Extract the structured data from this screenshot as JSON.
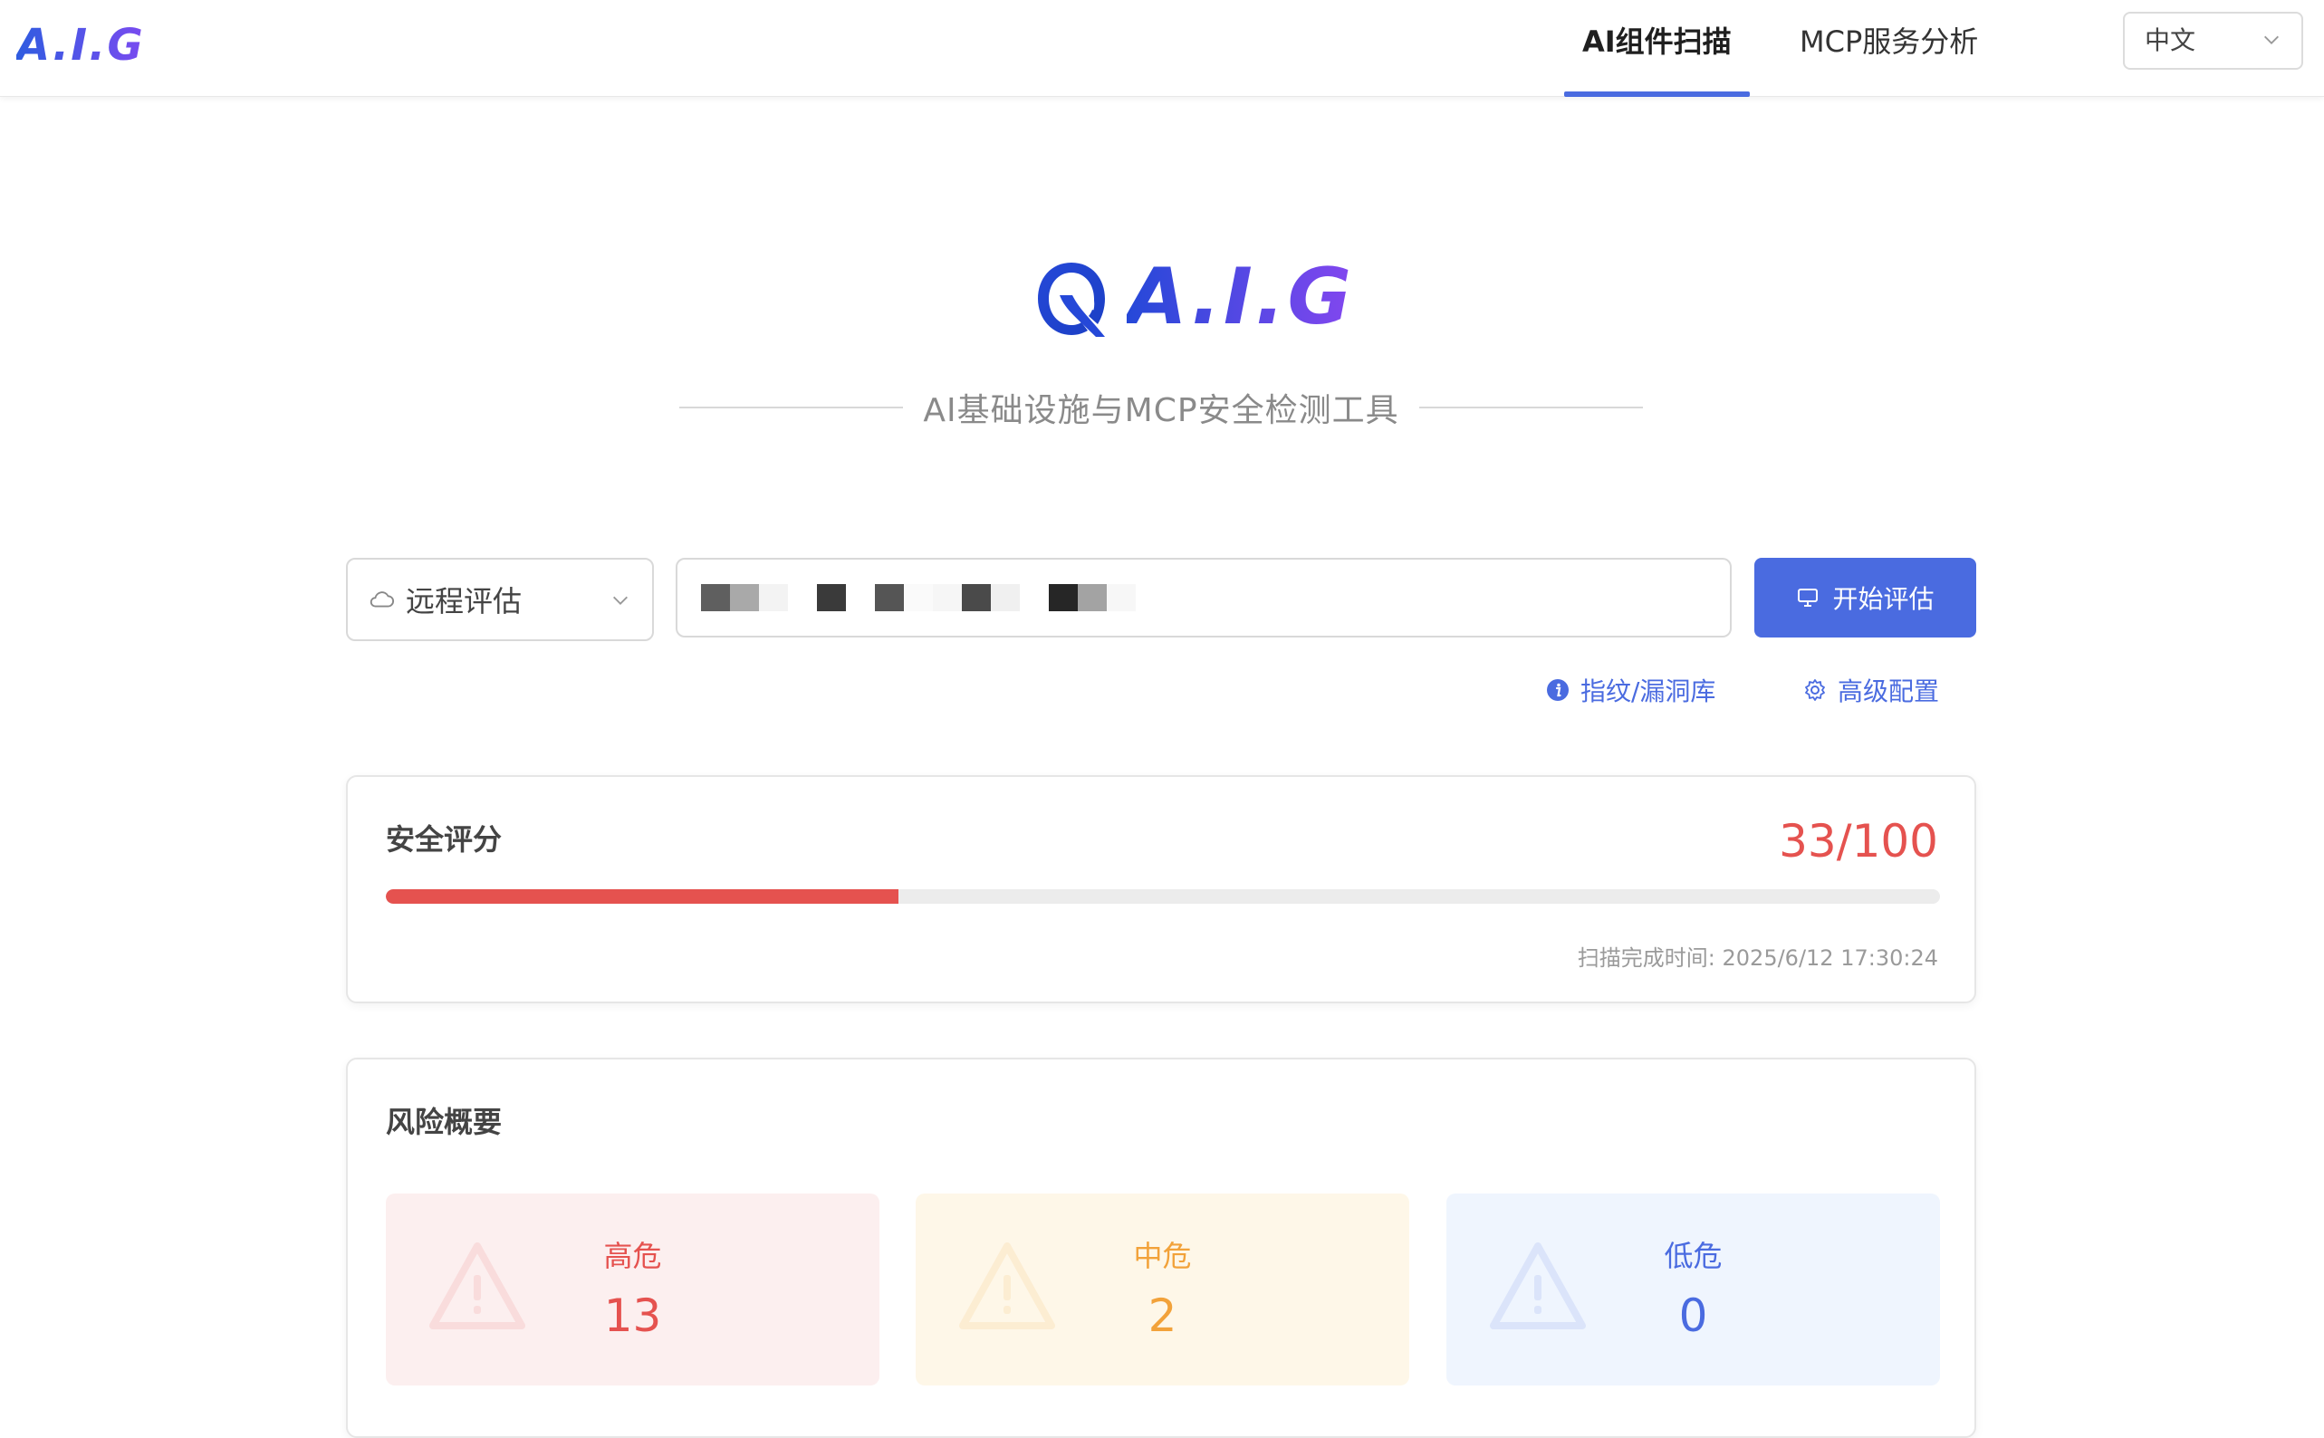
{
  "header": {
    "brand": "A.I.G",
    "tabs": [
      {
        "label": "AI组件扫描",
        "active": true
      },
      {
        "label": "MCP服务分析",
        "active": false
      }
    ],
    "language": "中文"
  },
  "hero": {
    "brand": "A.I.G",
    "subtitle": "AI基础设施与MCP安全检测工具"
  },
  "search": {
    "mode": "远程评估",
    "start_button": "开始评估",
    "links": {
      "fingerprint": "指纹/漏洞库",
      "advanced": "高级配置"
    }
  },
  "score_card": {
    "title": "安全评分",
    "score": "33/100",
    "progress_fraction": 0.33,
    "scan_time": "扫描完成时间: 2025/6/12 17:30:24"
  },
  "risk_card": {
    "title": "风险概要",
    "items": [
      {
        "label": "高危",
        "count": "13",
        "color": "#e5524f",
        "bg": "#fcefef"
      },
      {
        "label": "中危",
        "count": "2",
        "color": "#f2a23a",
        "bg": "#fef7e8"
      },
      {
        "label": "低危",
        "count": "0",
        "color": "#4a6be0",
        "bg": "#eff5fe"
      }
    ]
  },
  "colors": {
    "accent": "#4a6be0",
    "danger": "#e5524f"
  }
}
